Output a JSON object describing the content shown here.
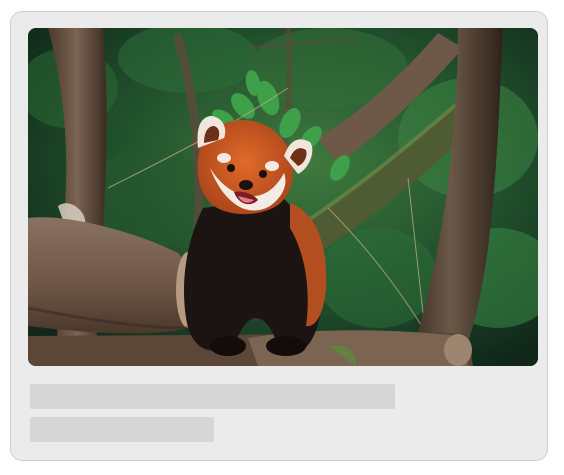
{
  "card": {
    "image": {
      "subject": "red panda",
      "alt": ""
    },
    "placeholder_lines": 2
  },
  "colors": {
    "card_background": "#ebebeb",
    "card_border": "#cfcfcf",
    "skeleton": "#d6d6d6",
    "page_background": "#ffffff"
  }
}
